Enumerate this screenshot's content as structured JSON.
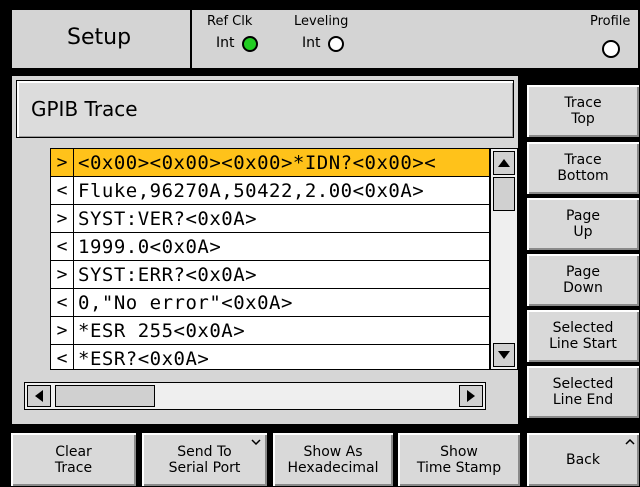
{
  "header": {
    "title": "Setup",
    "ref_clk_label": "Ref Clk",
    "ref_clk_value": "Int",
    "leveling_label": "Leveling",
    "leveling_value": "Int",
    "profile_label": "Profile"
  },
  "trace_panel": {
    "title": "GPIB Trace",
    "rows": [
      {
        "dir": ">",
        "text": "<0x00><0x00><0x00>*IDN?<0x00><"
      },
      {
        "dir": "<",
        "text": "Fluke,96270A,50422,2.00<0x0A>"
      },
      {
        "dir": ">",
        "text": "SYST:VER?<0x0A>"
      },
      {
        "dir": "<",
        "text": "1999.0<0x0A>"
      },
      {
        "dir": ">",
        "text": "SYST:ERR?<0x0A>"
      },
      {
        "dir": "<",
        "text": "0,\"No error\"<0x0A>"
      },
      {
        "dir": ">",
        "text": "*ESR 255<0x0A>"
      },
      {
        "dir": "<",
        "text": "*ESR?<0x0A>"
      }
    ]
  },
  "side_buttons": [
    {
      "line1": "Trace",
      "line2": "Top"
    },
    {
      "line1": "Trace",
      "line2": "Bottom"
    },
    {
      "line1": "Page",
      "line2": "Up"
    },
    {
      "line1": "Page",
      "line2": "Down"
    },
    {
      "line1": "Selected",
      "line2": "Line Start"
    },
    {
      "line1": "Selected",
      "line2": "Line End"
    }
  ],
  "bottom_buttons": [
    {
      "line1": "Clear",
      "line2": "Trace"
    },
    {
      "line1": "Send To",
      "line2": "Serial Port"
    },
    {
      "line1": "Show As",
      "line2": "Hexadecimal"
    },
    {
      "line1": "Show",
      "line2": "Time Stamp"
    },
    {
      "line1": "Back",
      "line2": ""
    }
  ],
  "colors": {
    "selected_row": "#ffc21a",
    "led_on": "#22cc22",
    "panel": "#d6d6d6"
  }
}
